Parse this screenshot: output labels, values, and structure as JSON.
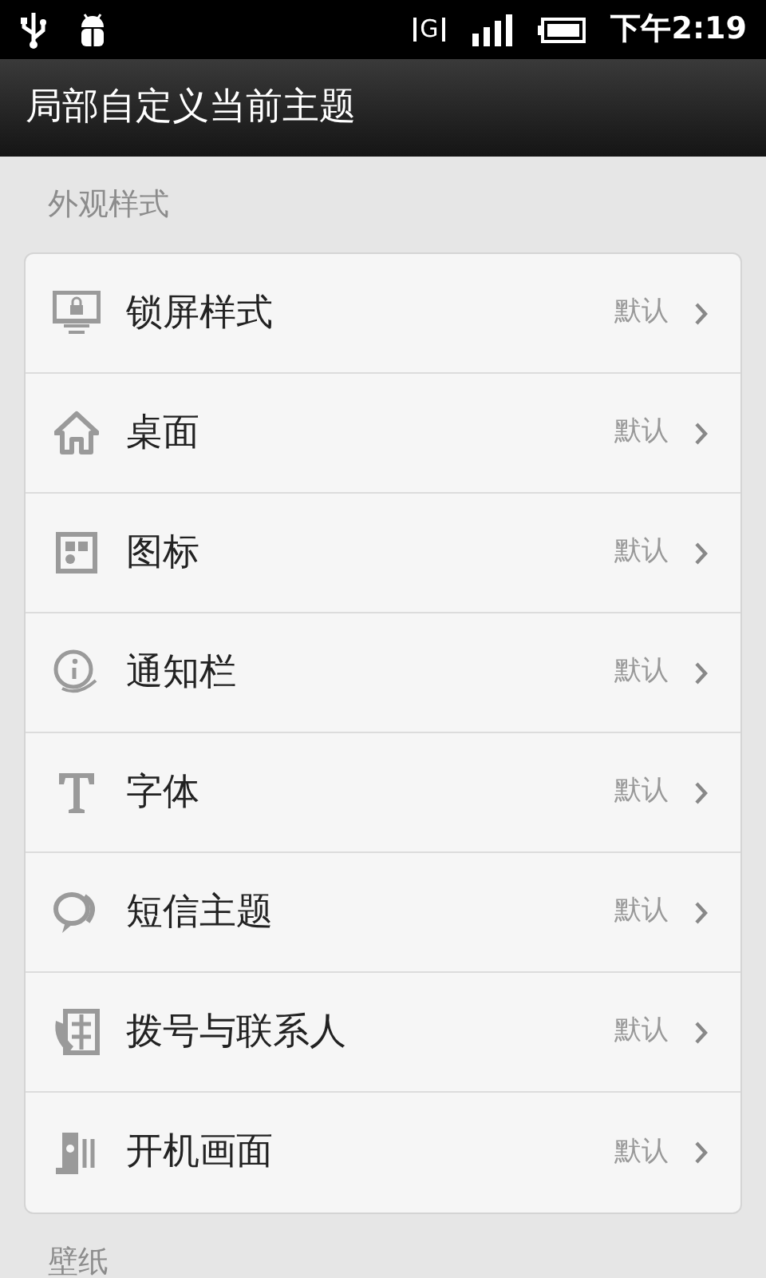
{
  "status_bar": {
    "time": "下午2:19",
    "network": "G"
  },
  "title_bar": {
    "title": "局部自定义当前主题"
  },
  "sections": [
    {
      "header": "外观样式",
      "items": [
        {
          "kind": "lockscreen",
          "label": "锁屏样式",
          "value": "默认"
        },
        {
          "kind": "home",
          "label": "桌面",
          "value": "默认"
        },
        {
          "kind": "icons",
          "label": "图标",
          "value": "默认"
        },
        {
          "kind": "notification",
          "label": "通知栏",
          "value": "默认"
        },
        {
          "kind": "font",
          "label": "字体",
          "value": "默认"
        },
        {
          "kind": "sms",
          "label": "短信主题",
          "value": "默认"
        },
        {
          "kind": "dialer",
          "label": "拨号与联系人",
          "value": "默认"
        },
        {
          "kind": "boot",
          "label": "开机画面",
          "value": "默认"
        }
      ]
    },
    {
      "header": "壁纸"
    }
  ]
}
